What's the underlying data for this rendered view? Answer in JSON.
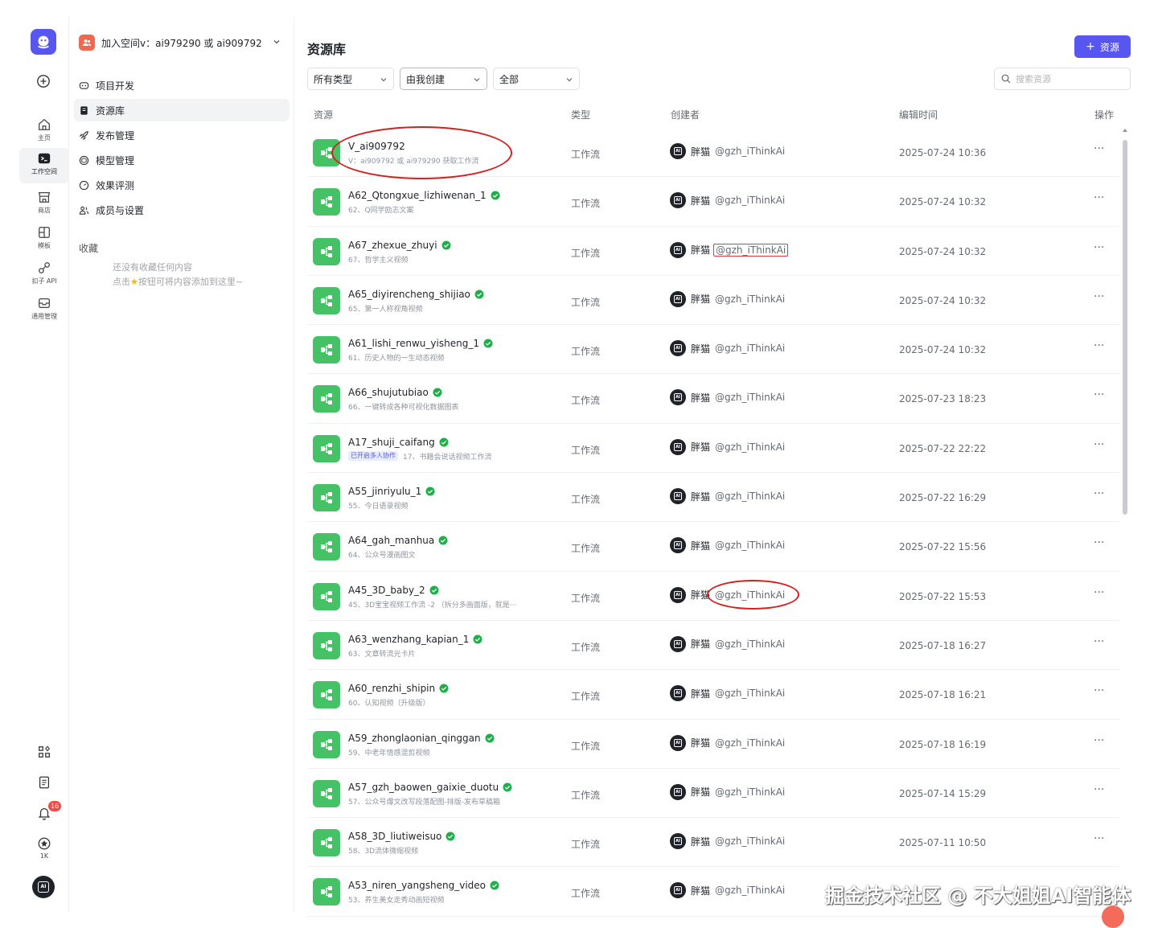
{
  "rail": {
    "items": [
      {
        "label": "主页",
        "icon": "home-icon"
      },
      {
        "label": "工作空间",
        "icon": "terminal-icon",
        "active": true
      },
      {
        "label": "商店",
        "icon": "store-icon"
      },
      {
        "label": "模板",
        "icon": "template-icon"
      },
      {
        "label": "扣子 API",
        "icon": "api-icon"
      },
      {
        "label": "通用管理",
        "icon": "inbox-icon"
      }
    ],
    "notifications_badge": "16",
    "stars_label": "1K"
  },
  "workspace": {
    "name": "加入空间v：ai979290 或 ai909792",
    "nav": [
      {
        "label": "项目开发"
      },
      {
        "label": "资源库",
        "active": true
      },
      {
        "label": "发布管理"
      },
      {
        "label": "模型管理"
      },
      {
        "label": "效果评测"
      },
      {
        "label": "成员与设置"
      }
    ],
    "favorites_title": "收藏",
    "favorites_empty_line1": "还没有收藏任何内容",
    "favorites_empty_line2_a": "点击",
    "favorites_empty_line2_b": "按钮可将内容添加到这里~"
  },
  "main": {
    "title": "资源库",
    "add_button": "资源",
    "filters": [
      "所有类型",
      "由我创建",
      "全部"
    ],
    "search_placeholder": "搜索资源",
    "columns": {
      "resource": "资源",
      "type": "类型",
      "creator": "创建者",
      "edit_time": "编辑时间",
      "actions": "操作"
    },
    "rows": [
      {
        "name": "V_ai909792",
        "desc": "V：ai909792 或 ai979290 获取工作流",
        "verified": false,
        "tag": "",
        "type": "工作流",
        "creator": "胖猫",
        "handle": "@gzh_iThinkAi",
        "time": "2025-07-24 10:36"
      },
      {
        "name": "A62_Qtongxue_lizhiwenan_1",
        "desc": "62、Q同学励志文案",
        "verified": true,
        "tag": "",
        "type": "工作流",
        "creator": "胖猫",
        "handle": "@gzh_iThinkAi",
        "time": "2025-07-24 10:32"
      },
      {
        "name": "A67_zhexue_zhuyi",
        "desc": "67、哲学主义视频",
        "verified": true,
        "tag": "",
        "type": "工作流",
        "creator": "胖猫",
        "handle": "@gzh_iThinkAi",
        "time": "2025-07-24 10:32"
      },
      {
        "name": "A65_diyirencheng_shijiao",
        "desc": "65、第一人称视角视频",
        "verified": true,
        "tag": "",
        "type": "工作流",
        "creator": "胖猫",
        "handle": "@gzh_iThinkAi",
        "time": "2025-07-24 10:32"
      },
      {
        "name": "A61_lishi_renwu_yisheng_1",
        "desc": "61、历史人物的一生动态视频",
        "verified": true,
        "tag": "",
        "type": "工作流",
        "creator": "胖猫",
        "handle": "@gzh_iThinkAi",
        "time": "2025-07-24 10:32"
      },
      {
        "name": "A66_shujutubiao",
        "desc": "66、一键转成各种可视化数据图表",
        "verified": true,
        "tag": "",
        "type": "工作流",
        "creator": "胖猫",
        "handle": "@gzh_iThinkAi",
        "time": "2025-07-23 18:23"
      },
      {
        "name": "A17_shuji_caifang",
        "desc": "17、书籍会说话视频工作流",
        "verified": true,
        "tag": "已开启多人协作",
        "type": "工作流",
        "creator": "胖猫",
        "handle": "@gzh_iThinkAi",
        "time": "2025-07-22 22:22"
      },
      {
        "name": "A55_jinriyulu_1",
        "desc": "55、今日语录视频",
        "verified": true,
        "tag": "",
        "type": "工作流",
        "creator": "胖猫",
        "handle": "@gzh_iThinkAi",
        "time": "2025-07-22 16:29"
      },
      {
        "name": "A64_gah_manhua",
        "desc": "64、公众号漫画图文",
        "verified": true,
        "tag": "",
        "type": "工作流",
        "creator": "胖猫",
        "handle": "@gzh_iThinkAi",
        "time": "2025-07-22 15:56"
      },
      {
        "name": "A45_3D_baby_2",
        "desc": "45、3D宝宝视频工作流 -2 （拆分多画面版，就是···",
        "verified": true,
        "tag": "",
        "type": "工作流",
        "creator": "胖猫",
        "handle": "@gzh_iThinkAi",
        "time": "2025-07-22 15:53"
      },
      {
        "name": "A63_wenzhang_kapian_1",
        "desc": "63、文章转流光卡片",
        "verified": true,
        "tag": "",
        "type": "工作流",
        "creator": "胖猫",
        "handle": "@gzh_iThinkAi",
        "time": "2025-07-18 16:27"
      },
      {
        "name": "A60_renzhi_shipin",
        "desc": "60、认知视频（升级版）",
        "verified": true,
        "tag": "",
        "type": "工作流",
        "creator": "胖猫",
        "handle": "@gzh_iThinkAi",
        "time": "2025-07-18 16:21"
      },
      {
        "name": "A59_zhonglaonian_qinggan",
        "desc": "59、中老年情感混剪视频",
        "verified": true,
        "tag": "",
        "type": "工作流",
        "creator": "胖猫",
        "handle": "@gzh_iThinkAi",
        "time": "2025-07-18 16:19"
      },
      {
        "name": "A57_gzh_baowen_gaixie_duotu",
        "desc": "57、公众号爆文改写段落配图-排版-发布草稿箱",
        "verified": true,
        "tag": "",
        "type": "工作流",
        "creator": "胖猫",
        "handle": "@gzh_iThinkAi",
        "time": "2025-07-14 15:29"
      },
      {
        "name": "A58_3D_liutiweisuo",
        "desc": "58、3D流体微缩视频",
        "verified": true,
        "tag": "",
        "type": "工作流",
        "creator": "胖猫",
        "handle": "@gzh_iThinkAi",
        "time": "2025-07-11 10:50"
      },
      {
        "name": "A53_niren_yangsheng_video",
        "desc": "53、养生美女走秀动画短视频",
        "verified": true,
        "tag": "",
        "type": "工作流",
        "creator": "胖猫",
        "handle": "@gzh_iThinkAi",
        "time": ""
      }
    ]
  },
  "watermark": "掘金技术社区 @ 不大姐姐AI智能体",
  "colors": {
    "accent": "#5856f0",
    "resource_icon": "#45c265",
    "verified": "#1faf4a",
    "annotation": "#d61f1f"
  }
}
